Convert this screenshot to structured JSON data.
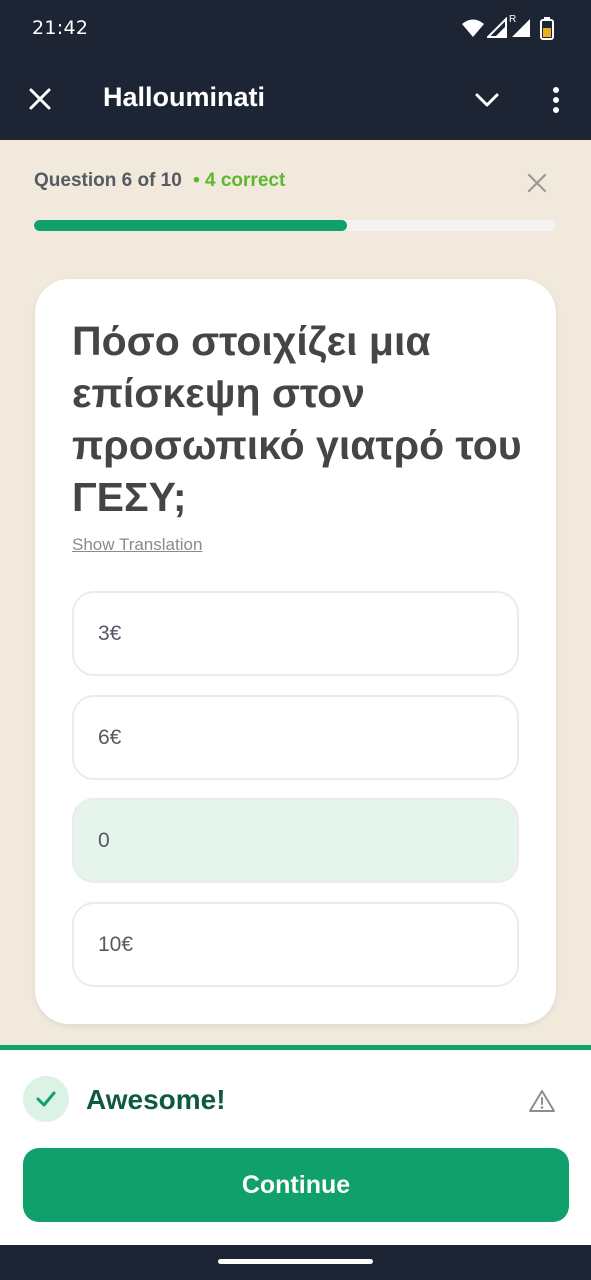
{
  "status_bar": {
    "time": "21:42",
    "icons": [
      "wifi-icon",
      "signal-icon",
      "signal-roaming-icon",
      "battery-icon"
    ],
    "roaming_mark": "R"
  },
  "app_bar": {
    "title": "Hallouminati",
    "icons": [
      "close-icon",
      "chevron-down-icon",
      "more-vertical-icon"
    ]
  },
  "quiz": {
    "question_counter": "Question 6 of 10",
    "correct_count": "• 4 correct",
    "progress_fraction": 0.6,
    "question": "Πόσο στοιχίζει μια επίσκεψη στον προσωπικό γιατρό του ΓΕΣΥ;",
    "show_translation": "Show Translation",
    "options": [
      {
        "label": "3€",
        "selected": false
      },
      {
        "label": "6€",
        "selected": false
      },
      {
        "label": "0",
        "selected": true
      },
      {
        "label": "10€",
        "selected": false
      }
    ]
  },
  "feedback": {
    "message": "Awesome!",
    "continue_label": "Continue",
    "icons": [
      "check-icon",
      "warning-icon"
    ]
  },
  "colors": {
    "primary_green": "#10a06c",
    "correct_green": "#5cb82e",
    "selected_option_bg": "#e6f5ec",
    "background_beige": "#f0e9dc",
    "dark_bar": "#1d2433"
  }
}
